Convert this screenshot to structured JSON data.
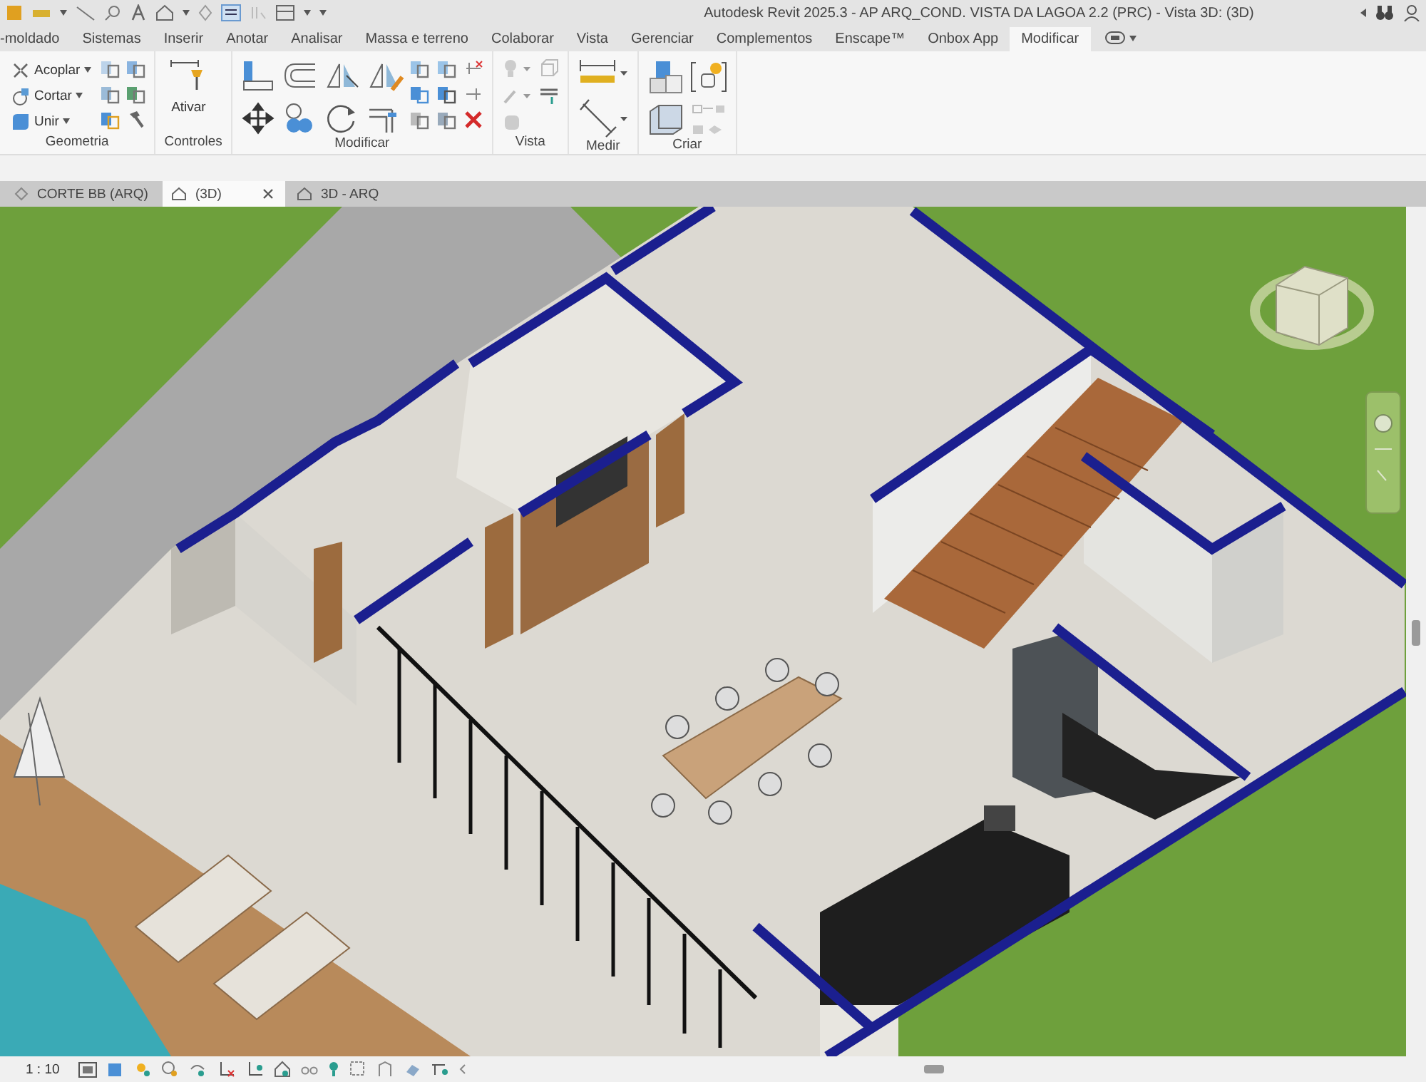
{
  "window": {
    "title": "Autodesk Revit 2025.3 - AP ARQ_COND. VISTA DA LAGOA 2.2 (PRC) - Vista 3D: (3D)"
  },
  "menu_tabs": [
    {
      "label": "-moldado",
      "selected": false
    },
    {
      "label": "Sistemas",
      "selected": false
    },
    {
      "label": "Inserir",
      "selected": false
    },
    {
      "label": "Anotar",
      "selected": false
    },
    {
      "label": "Analisar",
      "selected": false
    },
    {
      "label": "Massa e terreno",
      "selected": false
    },
    {
      "label": "Colaborar",
      "selected": false
    },
    {
      "label": "Vista",
      "selected": false
    },
    {
      "label": "Gerenciar",
      "selected": false
    },
    {
      "label": "Complementos",
      "selected": false
    },
    {
      "label": "Enscape™",
      "selected": false
    },
    {
      "label": "Onbox App",
      "selected": false
    },
    {
      "label": "Modificar",
      "selected": true
    }
  ],
  "ribbon": {
    "groups": [
      {
        "kind": "geometry",
        "label": "Geometria",
        "tools": [
          "Acoplar",
          "Cortar",
          "Unir"
        ]
      },
      {
        "kind": "controls",
        "label": "Controles",
        "tools": [
          "Ativar"
        ]
      },
      {
        "kind": "modify",
        "label": "Modificar"
      },
      {
        "kind": "view",
        "label": "Vista"
      },
      {
        "kind": "measure",
        "label": "Medir"
      },
      {
        "kind": "create",
        "label": "Criar"
      }
    ]
  },
  "doc_tabs": [
    {
      "label": "CORTE BB (ARQ)",
      "selected": false
    },
    {
      "label": "(3D)",
      "selected": true
    },
    {
      "label": "3D - ARQ",
      "selected": false
    }
  ],
  "status_bar": {
    "scale": "1 : 10"
  }
}
